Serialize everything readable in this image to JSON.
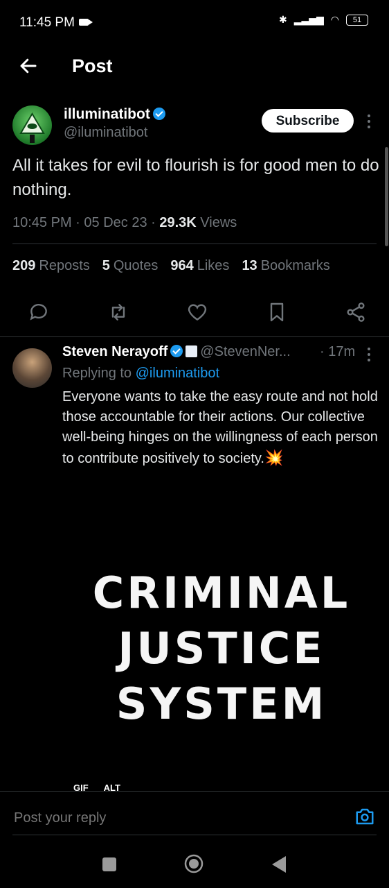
{
  "status_bar": {
    "time": "11:45 PM",
    "battery": "51"
  },
  "header": {
    "title": "Post"
  },
  "post": {
    "author_name": "illuminatibot",
    "author_handle": "@iluminatibot",
    "subscribe_label": "Subscribe",
    "text": "All it takes for evil to flourish is for good men to do nothing.",
    "time": "10:45 PM",
    "date": "05 Dec 23",
    "views_count": "29.3K",
    "views_label": "Views",
    "stats": {
      "reposts_count": "209",
      "reposts_label": "Reposts",
      "quotes_count": "5",
      "quotes_label": "Quotes",
      "likes_count": "964",
      "likes_label": "Likes",
      "bookmarks_count": "13",
      "bookmarks_label": "Bookmarks"
    }
  },
  "reply": {
    "author_name": "Steven Nerayoff",
    "author_handle": "@StevenNer...",
    "time": "· 17m",
    "replying_prefix": "Replying to",
    "replying_to": "@iluminatibot",
    "text": "Everyone wants to take the easy route and not hold those accountable for their actions. Our collective well-being hinges on the willingness of each person to contribute positively to society.",
    "emoji": "💥",
    "gif_lines": [
      "CRIMINAL",
      "JUSTICE",
      "SYSTEM"
    ],
    "gif_badge": "GIF",
    "alt_badge": "ALT"
  },
  "composer": {
    "placeholder": "Post your reply"
  },
  "colors": {
    "accent": "#1d9bf0",
    "background": "#000000",
    "muted": "#71767b"
  }
}
